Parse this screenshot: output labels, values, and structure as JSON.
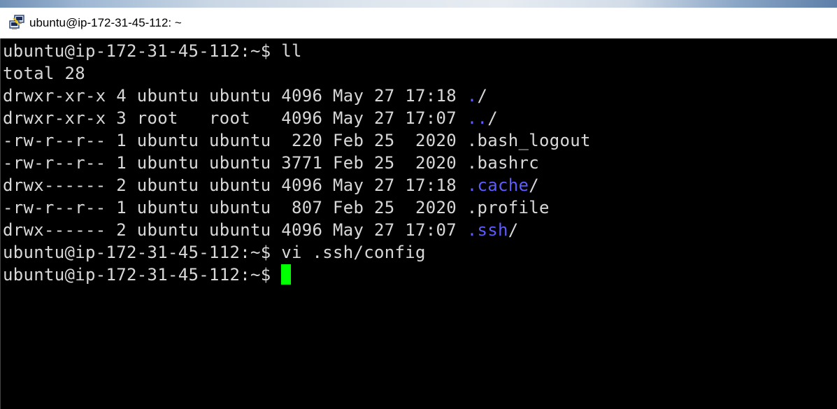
{
  "window": {
    "title": "ubuntu@ip-172-31-45-112: ~",
    "icon": "putty-terminal-icon"
  },
  "terminal": {
    "colors": {
      "background": "#000000",
      "foreground": "#d8d8d8",
      "directory": "#5c5cff",
      "cursor": "#00ff00"
    },
    "line1": {
      "prompt": "ubuntu@ip-172-31-45-112:~$ ",
      "command": "ll"
    },
    "line2": {
      "text": "total 28"
    },
    "entries": [
      {
        "meta": "drwxr-xr-x 4 ubuntu ubuntu 4096 May 27 17:18 ",
        "name": ".",
        "suffix": "/"
      },
      {
        "meta": "drwxr-xr-x 3 root   root   4096 May 27 17:07 ",
        "name": "..",
        "suffix": "/"
      },
      {
        "meta": "-rw-r--r-- 1 ubuntu ubuntu  220 Feb 25  2020 ",
        "name": ".bash_logout",
        "suffix": ""
      },
      {
        "meta": "-rw-r--r-- 1 ubuntu ubuntu 3771 Feb 25  2020 ",
        "name": ".bashrc",
        "suffix": ""
      },
      {
        "meta": "drwx------ 2 ubuntu ubuntu 4096 May 27 17:18 ",
        "name": ".cache",
        "suffix": "/"
      },
      {
        "meta": "-rw-r--r-- 1 ubuntu ubuntu  807 Feb 25  2020 ",
        "name": ".profile",
        "suffix": ""
      },
      {
        "meta": "drwx------ 2 ubuntu ubuntu 4096 May 27 17:07 ",
        "name": ".ssh",
        "suffix": "/"
      }
    ],
    "line10": {
      "prompt": "ubuntu@ip-172-31-45-112:~$ ",
      "command": "vi .ssh/config"
    },
    "line11": {
      "prompt": "ubuntu@ip-172-31-45-112:~$ ",
      "command": ""
    }
  }
}
